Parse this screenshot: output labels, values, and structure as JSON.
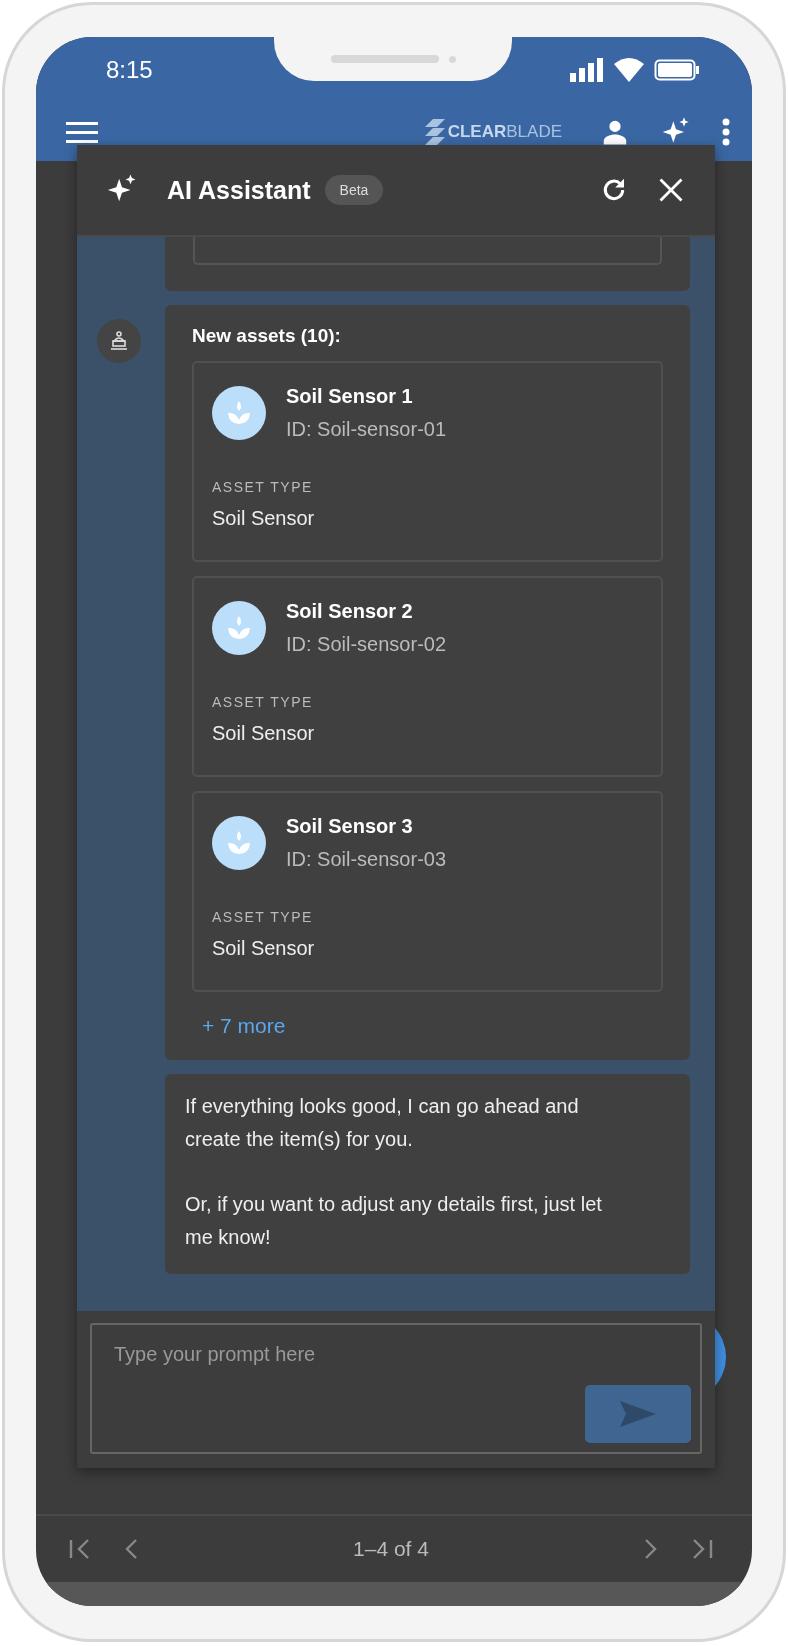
{
  "status_bar": {
    "time": "8:15"
  },
  "app_bar": {
    "logo": "**CLEAR**BLADE"
  },
  "assistant": {
    "title": "AI Assistant",
    "badge": "Beta",
    "messages": [
      {
        "kind": "partial",
        "avatar": false
      },
      {
        "kind": "assets",
        "avatar": true,
        "heading": "New assets (10):",
        "assets": [
          {
            "name": "Soil Sensor 1",
            "id": "ID: Soil-sensor-01",
            "type_label": "ASSET TYPE",
            "type": "Soil Sensor"
          },
          {
            "name": "Soil Sensor 2",
            "id": "ID: Soil-sensor-02",
            "type_label": "ASSET TYPE",
            "type": "Soil Sensor"
          },
          {
            "name": "Soil Sensor 3",
            "id": "ID: Soil-sensor-03",
            "type_label": "ASSET TYPE",
            "type": "Soil Sensor"
          }
        ],
        "more_link": "+ 7 more"
      },
      {
        "kind": "text",
        "avatar": false,
        "paragraphs": [
          "If everything looks good, I can go ahead and create the item(s) for you.",
          "Or, if you want to adjust any details first, just let me know!"
        ]
      }
    ],
    "input": {
      "placeholder": "Type your prompt here"
    }
  },
  "pagination": {
    "range": "1–4 of 4"
  }
}
